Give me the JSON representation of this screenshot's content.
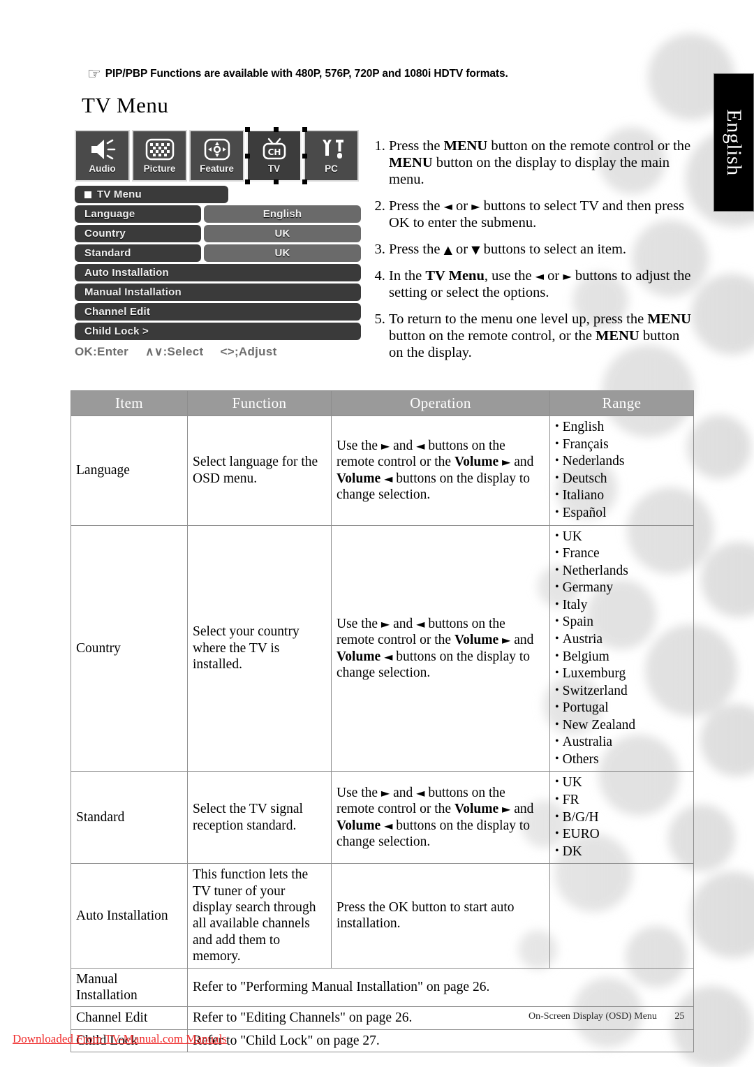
{
  "page": {
    "note": {
      "icon": "pointing-hand-icon",
      "text": "PIP/PBP Functions are available with 480P, 576P, 720P and 1080i HDTV formats."
    },
    "heading": "TV Menu",
    "side_tab": "English",
    "footer": {
      "section": "On-Screen Display (OSD) Menu",
      "page_number": "25"
    },
    "download_banner": "Downloaded From TV-Manual.com Manuals"
  },
  "osd": {
    "icon_tiles": [
      {
        "label": "Audio",
        "icon": "speaker-icon",
        "selected": false
      },
      {
        "label": "Picture",
        "icon": "checkerboard-icon",
        "selected": false
      },
      {
        "label": "Feature",
        "icon": "move-arrows-icon",
        "selected": false
      },
      {
        "label": "TV",
        "icon": "television-ch-icon",
        "selected": true
      },
      {
        "label": "PC",
        "icon": "wrench-tool-icon",
        "selected": false
      }
    ],
    "menu_title": "TV Menu",
    "rows": [
      {
        "label": "Language",
        "value": "English",
        "has_value": true
      },
      {
        "label": "Country",
        "value": "UK",
        "has_value": true
      },
      {
        "label": "Standard",
        "value": "UK",
        "has_value": true
      },
      {
        "label": "Auto Installation",
        "value": "",
        "has_value": false
      },
      {
        "label": "Manual Installation",
        "value": "",
        "has_value": false
      },
      {
        "label": "Channel Edit",
        "value": "",
        "has_value": false
      },
      {
        "label": "Child Lock >",
        "value": "",
        "has_value": false
      }
    ],
    "hint": {
      "ok": "OK:Enter",
      "select": "∧∨:Select",
      "adjust": "<>;Adjust"
    }
  },
  "instructions": [
    "Press the MENU button on the remote control or the MENU button on the display to display the main menu.",
    "Press the ◄ or ► buttons to select TV and then press OK to enter the submenu.",
    "Press the ▲ or ▼ buttons to select an item.",
    "In the TV Menu, use the ◄ or ► buttons to adjust the setting or select the options.",
    "To return to the menu one level up, press the MENU button on the remote control, or the MENU button on the display."
  ],
  "table": {
    "headers": [
      "Item",
      "Function",
      "Operation",
      "Range"
    ],
    "rows": [
      {
        "item": "Language",
        "function": "Select language for the OSD menu.",
        "operation": "Use the ► and ◄ buttons on the remote control or the Volume ► and Volume ◄ buttons on the display to change selection.",
        "range": [
          "English",
          "Français",
          "Nederlands",
          "Deutsch",
          "Italiano",
          "Español"
        ]
      },
      {
        "item": "Country",
        "function": "Select your country where the TV is installed.",
        "operation": "Use the ► and ◄ buttons on the remote control or the Volume ► and Volume ◄ buttons on the display to change selection.",
        "range": [
          "UK",
          "France",
          "Netherlands",
          "Germany",
          "Italy",
          "Spain",
          "Austria",
          "Belgium",
          "Luxemburg",
          "Switzerland",
          "Portugal",
          "New Zealand",
          "Australia",
          "Others"
        ]
      },
      {
        "item": "Standard",
        "function": "Select the TV signal reception standard.",
        "operation": "Use the ► and ◄ buttons on the remote control or the Volume ► and Volume ◄ buttons on the display to change selection.",
        "range": [
          "UK",
          "FR",
          "B/G/H",
          "EURO",
          "DK"
        ]
      },
      {
        "item": "Auto Installation",
        "function": "This function lets the TV tuner of your display search through all available channels and add them to memory.",
        "operation": "Press the OK button to start auto installation.",
        "range": []
      },
      {
        "item": "Manual Installation",
        "span_text": "Refer to \"Performing Manual Installation\" on page  26."
      },
      {
        "item": "Channel Edit",
        "span_text": "Refer to \"Editing Channels\" on page  26."
      },
      {
        "item": "Child Lock",
        "span_text": "Refer to \"Child Lock\" on page  27."
      }
    ]
  },
  "colors": {
    "table_header_bg": "#9a9a9a",
    "table_border": "#8d8d8d",
    "side_tab_bg": "#000000",
    "banner_red": "#ef2a2a",
    "osd_pill_bg": "#3a3a3a",
    "osd_value_bg": "#6a6a6a"
  }
}
